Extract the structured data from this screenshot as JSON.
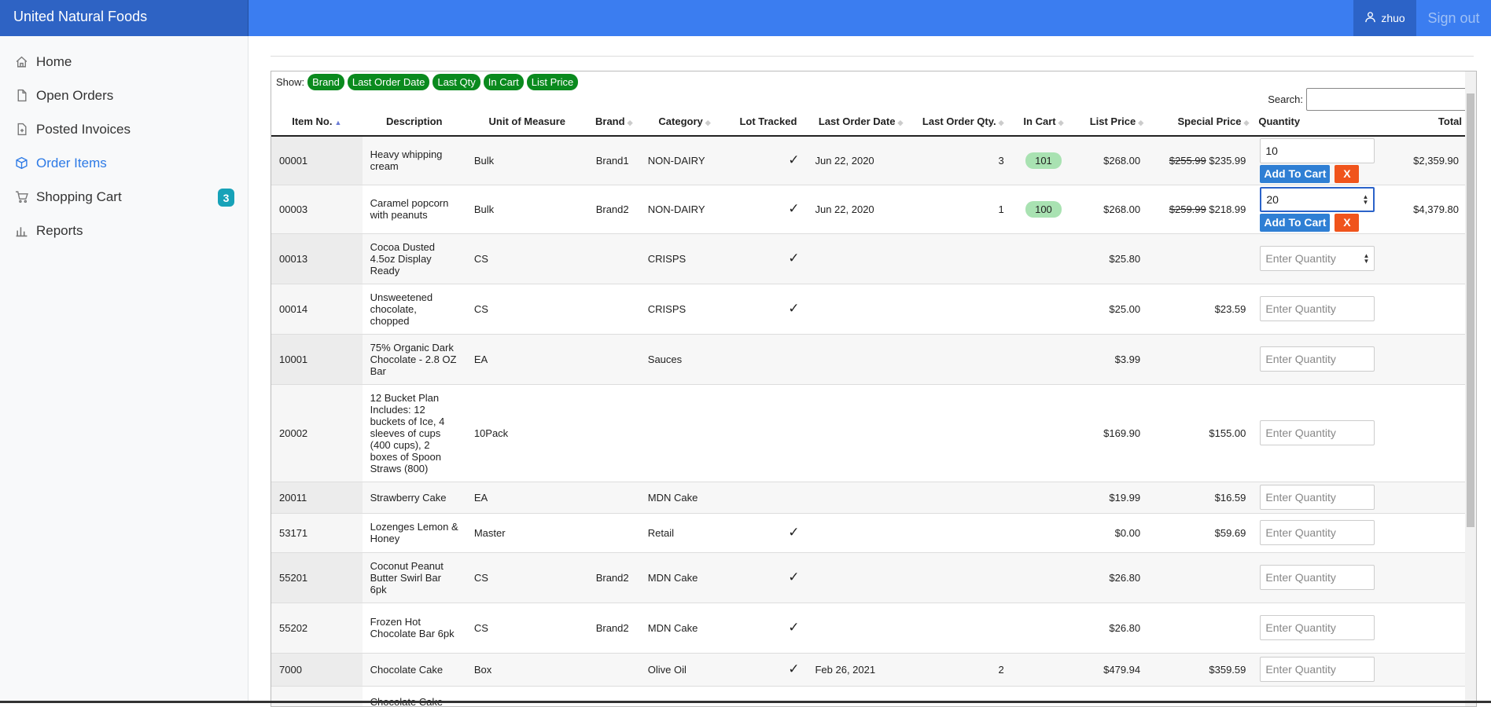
{
  "app": {
    "title": "United Natural Foods",
    "user": "zhuo",
    "signout": "Sign out"
  },
  "sidebar": {
    "items": [
      {
        "label": "Home",
        "icon": "home-icon"
      },
      {
        "label": "Open Orders",
        "icon": "document-icon"
      },
      {
        "label": "Posted Invoices",
        "icon": "invoice-icon"
      },
      {
        "label": "Order Items",
        "icon": "box-icon",
        "active": true
      },
      {
        "label": "Shopping Cart",
        "icon": "cart-icon",
        "badge": "3"
      },
      {
        "label": "Reports",
        "icon": "chart-icon"
      }
    ]
  },
  "toolbar": {
    "show_label": "Show:",
    "filters": [
      "Brand",
      "Last Order Date",
      "Last Qty",
      "In Cart",
      "List Price"
    ],
    "search_label": "Search:",
    "search_value": ""
  },
  "table": {
    "columns": [
      "Item No.",
      "Description",
      "Unit of Measure",
      "Brand",
      "Category",
      "Lot Tracked",
      "Last Order Date",
      "Last Order Qty.",
      "In Cart",
      "List Price",
      "Special Price",
      "Quantity",
      "Total"
    ],
    "qty_placeholder": "Enter Quantity",
    "add_label": "Add To Cart",
    "remove_label": "X",
    "rows": [
      {
        "no": "00001",
        "desc": "Heavy whipping cream",
        "uom": "Bulk",
        "brand": "Brand1",
        "cat": "NON-DAIRY",
        "lot": "✓",
        "date": "Jun 22, 2020",
        "lqty": "3",
        "cart": "101",
        "lp": "$268.00",
        "sp_old": "$255.99",
        "sp": "$235.99",
        "qty": "10",
        "total": "$2,359.90"
      },
      {
        "no": "00003",
        "desc": "Caramel popcorn with peanuts",
        "uom": "Bulk",
        "brand": "Brand2",
        "cat": "NON-DAIRY",
        "lot": "✓",
        "date": "Jun 22, 2020",
        "lqty": "1",
        "cart": "100",
        "lp": "$268.00",
        "sp_old": "$259.99",
        "sp": "$218.99",
        "qty": "20",
        "total": "$4,379.80"
      },
      {
        "no": "00013",
        "desc": "Cocoa Dusted 4.5oz Display Ready",
        "uom": "CS",
        "brand": "",
        "cat": "CRISPS",
        "lot": "✓",
        "date": "",
        "lqty": "",
        "cart": "",
        "lp": "$25.80",
        "sp_old": "",
        "sp": "",
        "qty": "",
        "total": ""
      },
      {
        "no": "00014",
        "desc": "Unsweetened chocolate, chopped",
        "uom": "CS",
        "brand": "",
        "cat": "CRISPS",
        "lot": "✓",
        "date": "",
        "lqty": "",
        "cart": "",
        "lp": "$25.00",
        "sp_old": "",
        "sp": "$23.59",
        "qty": "",
        "total": ""
      },
      {
        "no": "10001",
        "desc": "75% Organic Dark Chocolate - 2.8 OZ Bar",
        "uom": "EA",
        "brand": "",
        "cat": "Sauces",
        "lot": "",
        "date": "",
        "lqty": "",
        "cart": "",
        "lp": "$3.99",
        "sp_old": "",
        "sp": "",
        "qty": "",
        "total": ""
      },
      {
        "no": "20002",
        "desc": "12 Bucket Plan Includes: 12 buckets of Ice, 4 sleeves of cups (400 cups), 2 boxes of Spoon Straws (800)",
        "uom": "10Pack",
        "brand": "",
        "cat": "",
        "lot": "",
        "date": "",
        "lqty": "",
        "cart": "",
        "lp": "$169.90",
        "sp_old": "",
        "sp": "$155.00",
        "qty": "",
        "total": ""
      },
      {
        "no": "20011",
        "desc": "Strawberry Cake",
        "uom": "EA",
        "brand": "",
        "cat": "MDN Cake",
        "lot": "",
        "date": "",
        "lqty": "",
        "cart": "",
        "lp": "$19.99",
        "sp_old": "",
        "sp": "$16.59",
        "qty": "",
        "total": ""
      },
      {
        "no": "53171",
        "desc": "Lozenges Lemon & Honey",
        "uom": "Master",
        "brand": "",
        "cat": "Retail",
        "lot": "✓",
        "date": "",
        "lqty": "",
        "cart": "",
        "lp": "$0.00",
        "sp_old": "",
        "sp": "$59.69",
        "qty": "",
        "total": ""
      },
      {
        "no": "55201",
        "desc": "Coconut Peanut Butter Swirl Bar 6pk",
        "uom": "CS",
        "brand": "Brand2",
        "cat": "MDN Cake",
        "lot": "✓",
        "date": "",
        "lqty": "",
        "cart": "",
        "lp": "$26.80",
        "sp_old": "",
        "sp": "",
        "qty": "",
        "total": ""
      },
      {
        "no": "55202",
        "desc": "Frozen Hot Chocolate Bar 6pk",
        "uom": "CS",
        "brand": "Brand2",
        "cat": "MDN Cake",
        "lot": "✓",
        "date": "",
        "lqty": "",
        "cart": "",
        "lp": "$26.80",
        "sp_old": "",
        "sp": "",
        "qty": "",
        "total": ""
      },
      {
        "no": "7000",
        "desc": "Chocolate Cake",
        "uom": "Box",
        "brand": "",
        "cat": "Olive Oil",
        "lot": "✓",
        "date": "Feb 26, 2021",
        "lqty": "2",
        "cart": "",
        "lp": "$479.94",
        "sp_old": "",
        "sp": "$359.59",
        "qty": "",
        "total": ""
      },
      {
        "no": "",
        "desc": "Chocolate Cake",
        "uom": "",
        "brand": "",
        "cat": "",
        "lot": "",
        "date": "",
        "lqty": "",
        "cart": "",
        "lp": "",
        "sp_old": "",
        "sp": "",
        "qty": "",
        "total": ""
      }
    ]
  }
}
